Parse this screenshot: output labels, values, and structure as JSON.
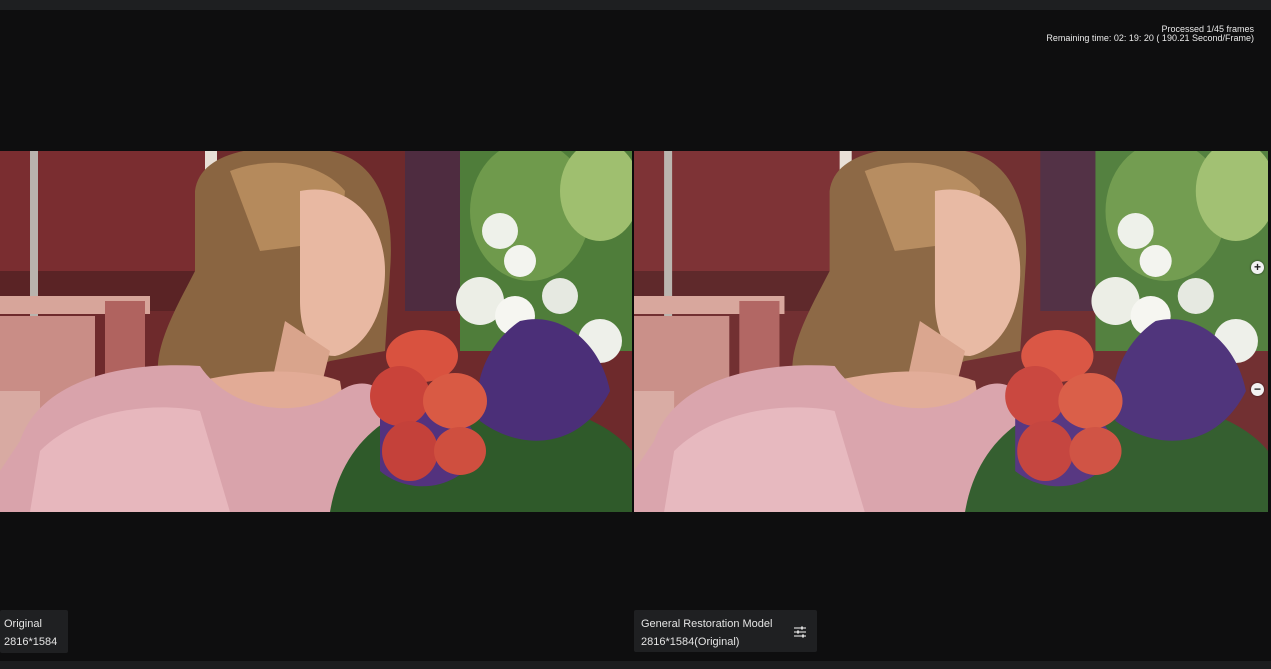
{
  "progress": {
    "processed": "Processed 1/45 frames",
    "remaining": "Remaining time: 02: 19: 20 ( 190.21 Second/Frame)"
  },
  "panes": {
    "left": {
      "label": "Original",
      "resolution": "2816*1584"
    },
    "right": {
      "label": "General Restoration Model",
      "resolution": "2816*1584(Original)"
    }
  },
  "controls": {
    "zoom_in_icon": "plus-icon",
    "zoom_out_icon": "minus-icon",
    "settings_icon": "sliders-icon"
  },
  "colors": {
    "background": "#0e0e0f",
    "card": "#1f2022",
    "text": "#e6e6e6"
  }
}
